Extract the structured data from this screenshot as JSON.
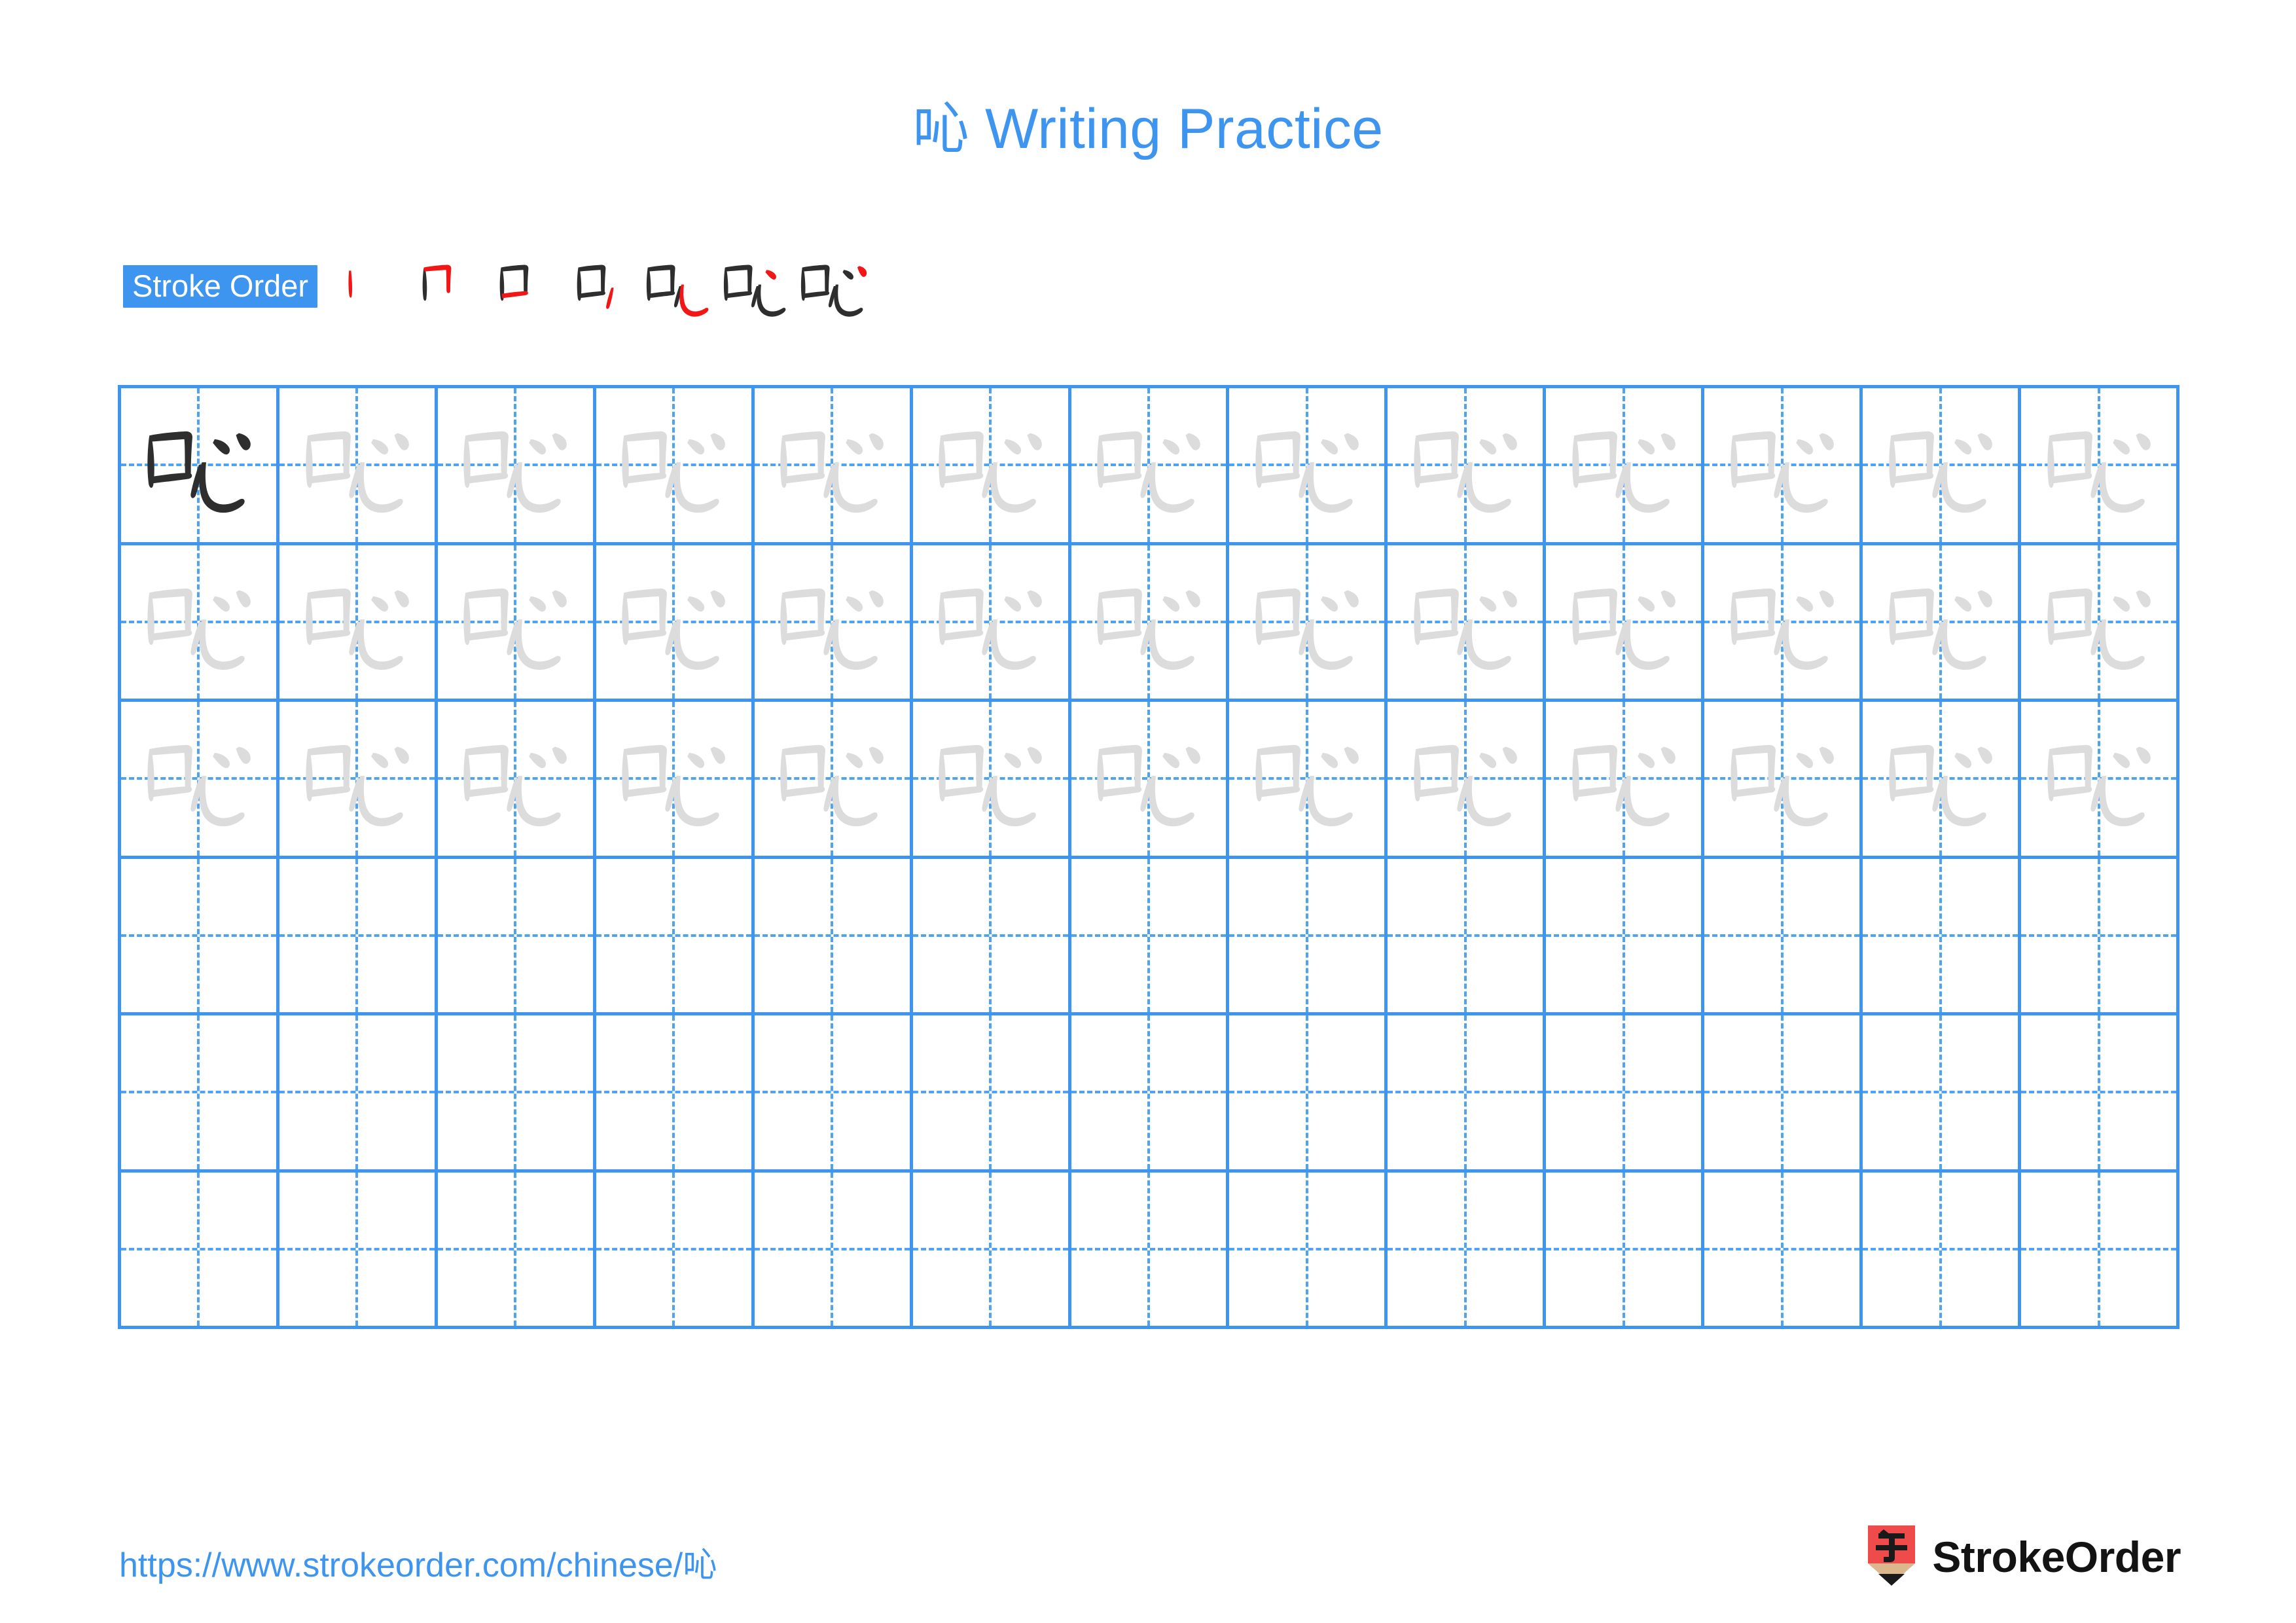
{
  "page": {
    "character": "吣",
    "title_prefix": "吣",
    "title_text": " Writing Practice",
    "accent_color": "#3d95f0",
    "grid_line_color": "#3d95f0",
    "dash_line_color": "#4fa3f5",
    "dark_char_color": "#2e2e2e",
    "light_char_color": "#dcdcdc",
    "stroke_new_color": "#f21616",
    "stroke_done_color": "#2e2e2e"
  },
  "stroke_order": {
    "badge_label": "Stroke Order",
    "stroke_count": 7,
    "steps": [
      {
        "index": 1,
        "label": "stroke-step-1",
        "new_stroke": "丨"
      },
      {
        "index": 2,
        "label": "stroke-step-2",
        "new_stroke": "𠃍"
      },
      {
        "index": 3,
        "label": "stroke-step-3",
        "new_stroke": "一"
      },
      {
        "index": 4,
        "label": "stroke-step-4",
        "new_stroke": "㇃"
      },
      {
        "index": 5,
        "label": "stroke-step-5",
        "new_stroke": "㇂"
      },
      {
        "index": 6,
        "label": "stroke-step-6",
        "new_stroke": "丶"
      },
      {
        "index": 7,
        "label": "stroke-step-7",
        "new_stroke": "丶"
      }
    ]
  },
  "practice_grid": {
    "columns": 13,
    "rows": 6,
    "row_fill": [
      [
        "dark",
        "light",
        "light",
        "light",
        "light",
        "light",
        "light",
        "light",
        "light",
        "light",
        "light",
        "light",
        "light"
      ],
      [
        "light",
        "light",
        "light",
        "light",
        "light",
        "light",
        "light",
        "light",
        "light",
        "light",
        "light",
        "light",
        "light"
      ],
      [
        "light",
        "light",
        "light",
        "light",
        "light",
        "light",
        "light",
        "light",
        "light",
        "light",
        "light",
        "light",
        "light"
      ],
      [
        "empty",
        "empty",
        "empty",
        "empty",
        "empty",
        "empty",
        "empty",
        "empty",
        "empty",
        "empty",
        "empty",
        "empty",
        "empty"
      ],
      [
        "empty",
        "empty",
        "empty",
        "empty",
        "empty",
        "empty",
        "empty",
        "empty",
        "empty",
        "empty",
        "empty",
        "empty",
        "empty"
      ],
      [
        "empty",
        "empty",
        "empty",
        "empty",
        "empty",
        "empty",
        "empty",
        "empty",
        "empty",
        "empty",
        "empty",
        "empty",
        "empty"
      ]
    ]
  },
  "footer": {
    "url_prefix": "https://www.strokeorder.com/chinese/",
    "url_character": "吣",
    "brand_name": "StrokeOrder",
    "logo_glyph": "字",
    "logo_body_color": "#ef4b4b",
    "logo_wood_color": "#dcb68c",
    "logo_tip_color": "#1a1a1a"
  }
}
